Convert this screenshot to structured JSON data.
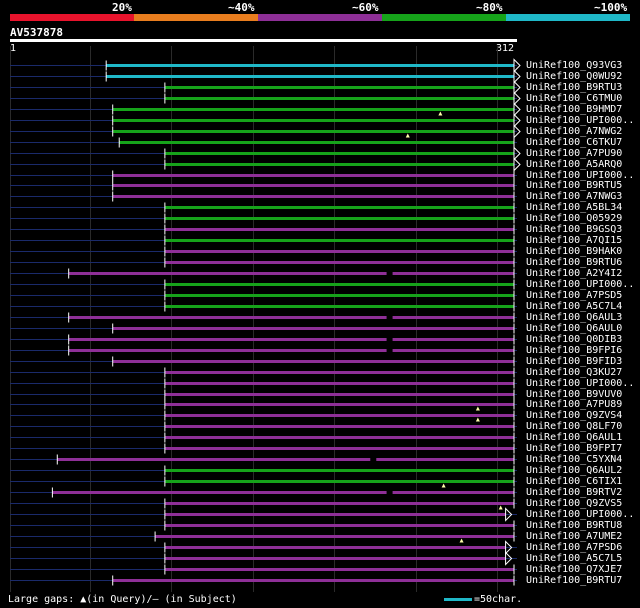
{
  "legend": {
    "labels": [
      "20%",
      "~40%",
      "~60%",
      "~80%",
      "~100%"
    ],
    "colors": [
      "#e8132c",
      "#e87d1e",
      "#8e2f97",
      "#16a31a",
      "#1fb8c8"
    ]
  },
  "query": {
    "name": "AV537878",
    "start": "1",
    "end": "312",
    "length": 312
  },
  "colors": {
    "cyan": "#1fb8c8",
    "green": "#16a31a",
    "purple": "#8e2f97",
    "navy": "#1a2a6a",
    "gap": "#ffffaa"
  },
  "footer": {
    "gaps": "Large gaps: ▲(in Query)/– (in Subject)",
    "scale": "=50char."
  },
  "hits": [
    {
      "name": "UniRef100_Q93VG3",
      "color": "cyan",
      "start": 60,
      "end": 312,
      "arrow": true,
      "gaps": [],
      "sgaps": []
    },
    {
      "name": "UniRef100_Q0WU92",
      "color": "cyan",
      "start": 60,
      "end": 312,
      "arrow": true,
      "gaps": [],
      "sgaps": []
    },
    {
      "name": "UniRef100_B9RTU3",
      "color": "green",
      "start": 96,
      "end": 312,
      "arrow": true,
      "gaps": [],
      "sgaps": []
    },
    {
      "name": "UniRef100_C6TMU0",
      "color": "green",
      "start": 96,
      "end": 312,
      "arrow": true,
      "gaps": [],
      "sgaps": []
    },
    {
      "name": "UniRef100_B9HMD7",
      "color": "green",
      "start": 64,
      "end": 312,
      "arrow": true,
      "gaps": [
        265
      ],
      "sgaps": []
    },
    {
      "name": "UniRef100_UPI000..",
      "color": "green",
      "start": 64,
      "end": 334,
      "arrow": true,
      "gaps": [],
      "sgaps": []
    },
    {
      "name": "UniRef100_A7NWG2",
      "color": "green",
      "start": 64,
      "end": 334,
      "arrow": true,
      "gaps": [
        245
      ],
      "sgaps": []
    },
    {
      "name": "UniRef100_C6TKU7",
      "color": "green",
      "start": 68,
      "end": 312,
      "arrow": false,
      "gaps": [],
      "sgaps": []
    },
    {
      "name": "UniRef100_A7PU90",
      "color": "green",
      "start": 96,
      "end": 312,
      "arrow": true,
      "gaps": [],
      "sgaps": []
    },
    {
      "name": "UniRef100_A5ARQ0",
      "color": "green",
      "start": 96,
      "end": 312,
      "arrow": true,
      "gaps": [],
      "sgaps": []
    },
    {
      "name": "UniRef100_UPI000..",
      "color": "purple",
      "start": 64,
      "end": 312,
      "arrow": false,
      "gaps": [],
      "sgaps": []
    },
    {
      "name": "UniRef100_B9RTU5",
      "color": "purple",
      "start": 64,
      "end": 312,
      "arrow": false,
      "gaps": [],
      "sgaps": []
    },
    {
      "name": "UniRef100_A7NWG3",
      "color": "purple",
      "start": 64,
      "end": 312,
      "arrow": false,
      "gaps": [],
      "sgaps": []
    },
    {
      "name": "UniRef100_A5BL34",
      "color": "green",
      "start": 96,
      "end": 312,
      "arrow": false,
      "gaps": [],
      "sgaps": []
    },
    {
      "name": "UniRef100_Q05929",
      "color": "green",
      "start": 96,
      "end": 312,
      "arrow": false,
      "gaps": [],
      "sgaps": []
    },
    {
      "name": "UniRef100_B9GSQ3",
      "color": "purple",
      "start": 96,
      "end": 312,
      "arrow": false,
      "gaps": [],
      "sgaps": []
    },
    {
      "name": "UniRef100_A7QI15",
      "color": "green",
      "start": 96,
      "end": 312,
      "arrow": false,
      "gaps": [],
      "sgaps": []
    },
    {
      "name": "UniRef100_B9HAK0",
      "color": "purple",
      "start": 96,
      "end": 312,
      "arrow": false,
      "gaps": [],
      "sgaps": []
    },
    {
      "name": "UniRef100_B9RTU6",
      "color": "purple",
      "start": 96,
      "end": 312,
      "arrow": false,
      "gaps": [],
      "sgaps": []
    },
    {
      "name": "UniRef100_A2Y4I2",
      "color": "purple",
      "start": 37,
      "end": 312,
      "arrow": false,
      "gaps": [],
      "sgaps": [
        232
      ]
    },
    {
      "name": "UniRef100_UPI000..",
      "color": "green",
      "start": 96,
      "end": 312,
      "arrow": false,
      "gaps": [],
      "sgaps": []
    },
    {
      "name": "UniRef100_A7PSD5",
      "color": "green",
      "start": 96,
      "end": 312,
      "arrow": false,
      "gaps": [],
      "sgaps": []
    },
    {
      "name": "UniRef100_A5C7L4",
      "color": "green",
      "start": 96,
      "end": 312,
      "arrow": false,
      "gaps": [],
      "sgaps": []
    },
    {
      "name": "UniRef100_Q6AUL3",
      "color": "purple",
      "start": 37,
      "end": 312,
      "arrow": false,
      "gaps": [],
      "sgaps": [
        232
      ]
    },
    {
      "name": "UniRef100_Q6AUL0",
      "color": "purple",
      "start": 64,
      "end": 312,
      "arrow": false,
      "gaps": [],
      "sgaps": []
    },
    {
      "name": "UniRef100_Q0DIB3",
      "color": "purple",
      "start": 37,
      "end": 312,
      "arrow": false,
      "gaps": [],
      "sgaps": [
        232
      ]
    },
    {
      "name": "UniRef100_B9FPI6",
      "color": "purple",
      "start": 37,
      "end": 312,
      "arrow": false,
      "gaps": [],
      "sgaps": [
        232
      ]
    },
    {
      "name": "UniRef100_B9FID3",
      "color": "purple",
      "start": 64,
      "end": 312,
      "arrow": false,
      "gaps": [],
      "sgaps": []
    },
    {
      "name": "UniRef100_Q3KU27",
      "color": "purple",
      "start": 96,
      "end": 312,
      "arrow": false,
      "gaps": [],
      "sgaps": []
    },
    {
      "name": "UniRef100_UPI000..",
      "color": "purple",
      "start": 96,
      "end": 312,
      "arrow": false,
      "gaps": [],
      "sgaps": []
    },
    {
      "name": "UniRef100_B9VUV0",
      "color": "purple",
      "start": 96,
      "end": 312,
      "arrow": false,
      "gaps": [],
      "sgaps": []
    },
    {
      "name": "UniRef100_A7PU89",
      "color": "purple",
      "start": 96,
      "end": 312,
      "arrow": false,
      "gaps": [
        288
      ],
      "sgaps": []
    },
    {
      "name": "UniRef100_Q9ZVS4",
      "color": "purple",
      "start": 96,
      "end": 312,
      "arrow": false,
      "gaps": [
        288
      ],
      "sgaps": []
    },
    {
      "name": "UniRef100_Q8LF70",
      "color": "purple",
      "start": 96,
      "end": 312,
      "arrow": false,
      "gaps": [],
      "sgaps": []
    },
    {
      "name": "UniRef100_Q6AUL1",
      "color": "purple",
      "start": 96,
      "end": 312,
      "arrow": false,
      "gaps": [],
      "sgaps": []
    },
    {
      "name": "UniRef100_B9FPI7",
      "color": "purple",
      "start": 96,
      "end": 312,
      "arrow": false,
      "gaps": [],
      "sgaps": []
    },
    {
      "name": "UniRef100_C5YXN4",
      "color": "purple",
      "start": 30,
      "end": 312,
      "arrow": false,
      "gaps": [],
      "sgaps": [
        222
      ]
    },
    {
      "name": "UniRef100_Q6AUL2",
      "color": "green",
      "start": 96,
      "end": 312,
      "arrow": false,
      "gaps": [],
      "sgaps": []
    },
    {
      "name": "UniRef100_C6TIX1",
      "color": "green",
      "start": 96,
      "end": 312,
      "arrow": false,
      "gaps": [
        267
      ],
      "sgaps": []
    },
    {
      "name": "UniRef100_B9RTV2",
      "color": "purple",
      "start": 27,
      "end": 312,
      "arrow": false,
      "gaps": [],
      "sgaps": [
        232
      ]
    },
    {
      "name": "UniRef100_Q9ZVS5",
      "color": "purple",
      "start": 96,
      "end": 312,
      "arrow": false,
      "gaps": [
        302
      ],
      "sgaps": []
    },
    {
      "name": "UniRef100_UPI000..",
      "color": "purple",
      "start": 96,
      "end": 305,
      "arrow": true,
      "gaps": [],
      "sgaps": []
    },
    {
      "name": "UniRef100_B9RTU8",
      "color": "purple",
      "start": 96,
      "end": 312,
      "arrow": false,
      "gaps": [],
      "sgaps": []
    },
    {
      "name": "UniRef100_A7UME2",
      "color": "purple",
      "start": 90,
      "end": 312,
      "arrow": false,
      "gaps": [
        278
      ],
      "sgaps": []
    },
    {
      "name": "UniRef100_A7PSD6",
      "color": "purple",
      "start": 96,
      "end": 305,
      "arrow": true,
      "gaps": [],
      "sgaps": []
    },
    {
      "name": "UniRef100_A5C7L5",
      "color": "purple",
      "start": 96,
      "end": 305,
      "arrow": true,
      "gaps": [],
      "sgaps": []
    },
    {
      "name": "UniRef100_Q7XJE7",
      "color": "purple",
      "start": 96,
      "end": 312,
      "arrow": false,
      "gaps": [],
      "sgaps": []
    },
    {
      "name": "UniRef100_B9RTU7",
      "color": "purple",
      "start": 64,
      "end": 312,
      "arrow": false,
      "gaps": [],
      "sgaps": []
    }
  ]
}
